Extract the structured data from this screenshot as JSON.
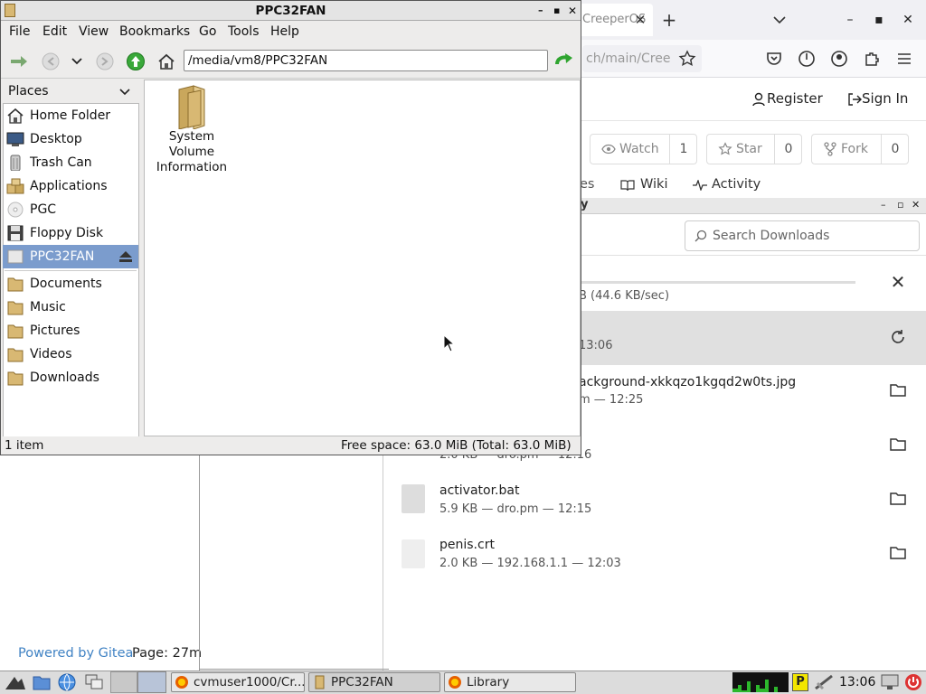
{
  "firefox": {
    "tab_title": "CreeperOS",
    "url_fragment": "ch/main/Cree",
    "register_label": "Register",
    "signin_label": "Sign In",
    "watch_label": "Watch",
    "watch_count": "1",
    "star_label": "Star",
    "star_count": "0",
    "fork_label": "Fork",
    "fork_count": "0",
    "tab_partial": "es",
    "wiki_label": "Wiki",
    "activity_label": "Activity",
    "powered_by": "Powered by Gitea",
    "page_time": "Page: 27m"
  },
  "library": {
    "title_partial": "y",
    "search_placeholder": "Search Downloads",
    "downloads": [
      {
        "name": "",
        "meta": "B (44.6 KB/sec)"
      },
      {
        "name": "",
        "meta": "13:06"
      },
      {
        "name": "ackground-xkkqzo1kgqd2w0ts.jpg",
        "meta": "m — 12:25"
      },
      {
        "name": "",
        "meta": "2.0 KB — dro.pm — 12:16"
      },
      {
        "name": "activator.bat",
        "meta": "5.9 KB — dro.pm — 12:15"
      },
      {
        "name": "penis.crt",
        "meta": "2.0 KB — 192.168.1.1 — 12:03"
      }
    ]
  },
  "filemanager": {
    "title": "PPC32FAN",
    "menu": [
      "File",
      "Edit",
      "View",
      "Bookmarks",
      "Go",
      "Tools",
      "Help"
    ],
    "path": "/media/vm8/PPC32FAN",
    "places_label": "Places",
    "places": [
      {
        "label": "Home Folder",
        "icon": "home-icon"
      },
      {
        "label": "Desktop",
        "icon": "desktop-icon"
      },
      {
        "label": "Trash Can",
        "icon": "trash-icon"
      },
      {
        "label": "Applications",
        "icon": "applications-icon"
      },
      {
        "label": "PGC",
        "icon": "disc-icon"
      },
      {
        "label": "Floppy Disk",
        "icon": "floppy-icon"
      },
      {
        "label": "PPC32FAN",
        "icon": "drive-icon",
        "selected": true
      }
    ],
    "bookmarks": [
      {
        "label": "Documents"
      },
      {
        "label": "Music"
      },
      {
        "label": "Pictures"
      },
      {
        "label": "Videos"
      },
      {
        "label": "Downloads"
      }
    ],
    "files": [
      {
        "line1": "System",
        "line2": "Volume",
        "line3": "Information"
      }
    ],
    "status_items": "1 item",
    "status_space": "Free space: 63.0 MiB (Total: 63.0 MiB)"
  },
  "taskbar": {
    "tasks": [
      "cvmuser1000/Cr...",
      "PPC32FAN",
      "Library"
    ],
    "clock": "13:06"
  },
  "colors": {
    "selection": "#7b9ccd",
    "gitea_link": "#4183c4",
    "go_arrow": "#2fa52f"
  }
}
